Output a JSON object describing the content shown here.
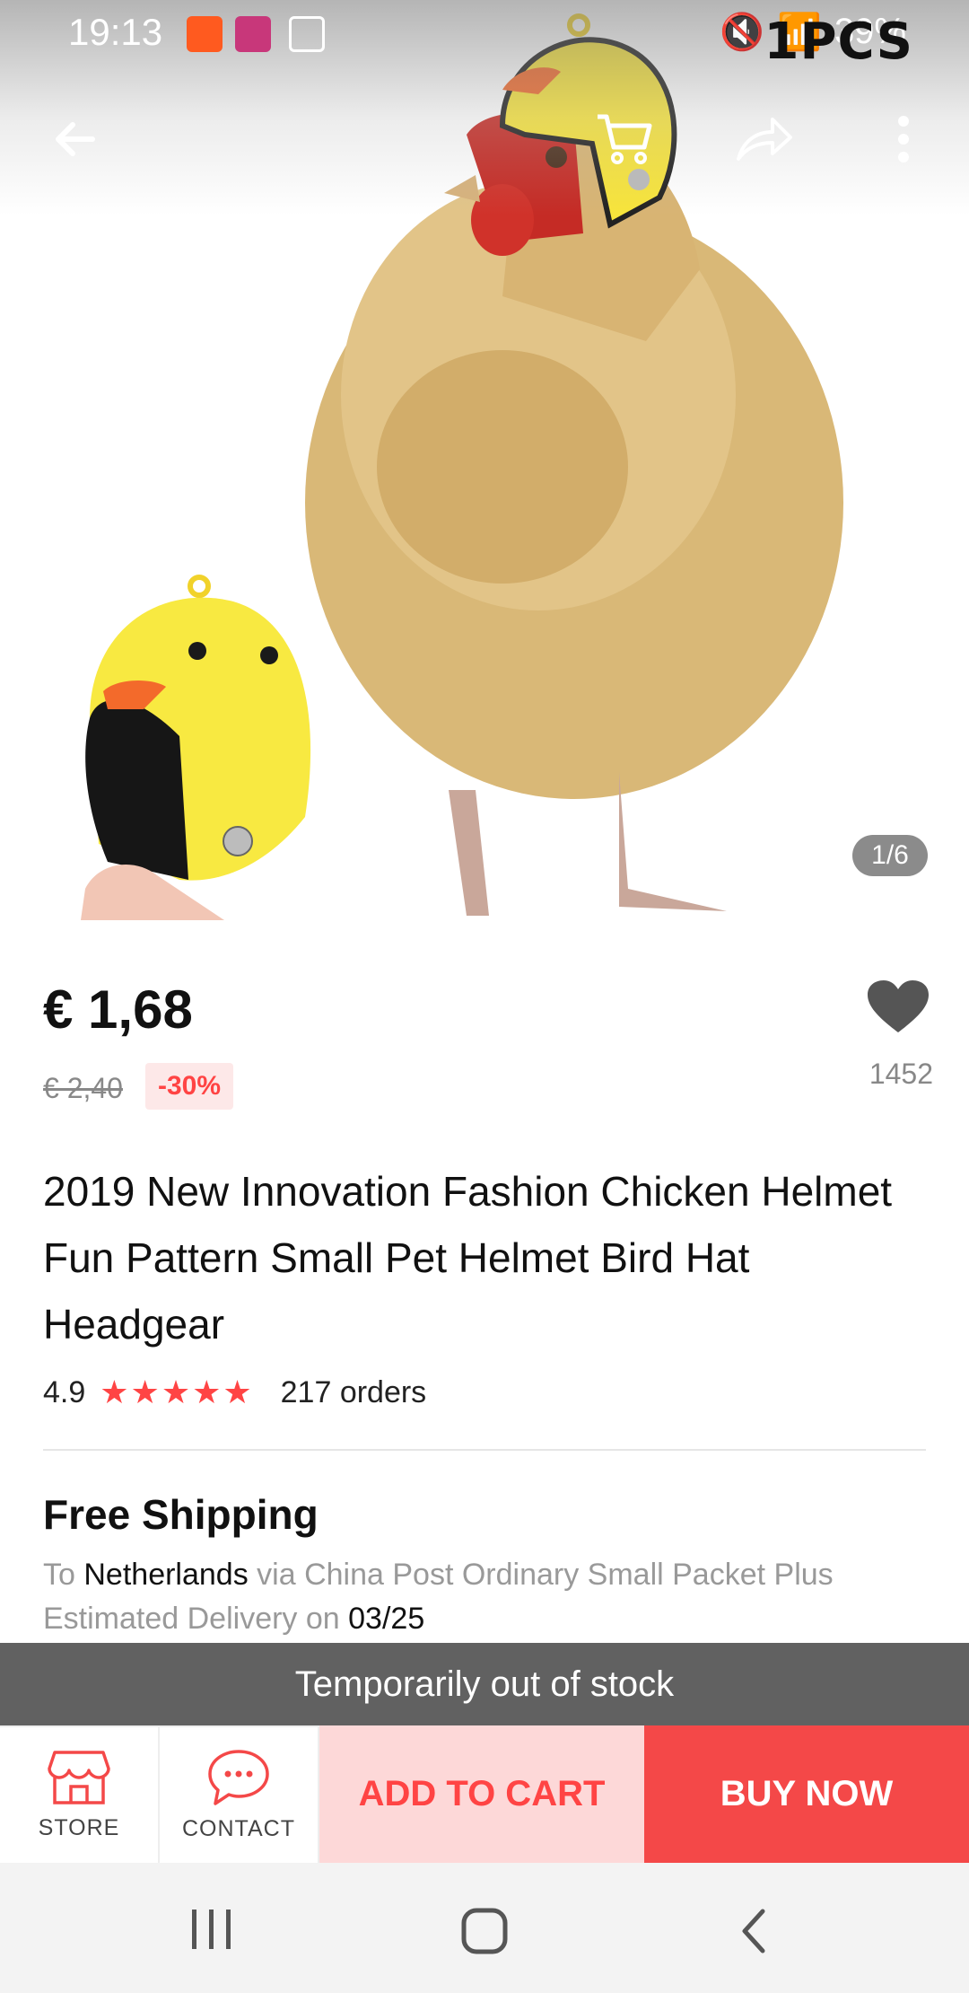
{
  "status": {
    "time": "19:13",
    "battery": "39%",
    "overlay_text": "1PCS"
  },
  "gallery": {
    "counter": "1/6"
  },
  "product": {
    "price": "€ 1,68",
    "original_price": "€ 2,40",
    "discount": "-30%",
    "wishlist_count": "1452",
    "title": "2019 New Innovation Fashion Chicken Helmet Fun Pattern Small Pet Helmet Bird Hat Headgear",
    "rating": "4.9",
    "stars": "★★★★★",
    "orders": "217 orders"
  },
  "shipping": {
    "title": "Free Shipping",
    "to_prefix": "To",
    "country": "Netherlands",
    "via": "via China Post Ordinary Small Packet Plus",
    "estimated_prefix": "Estimated Delivery on",
    "date": "03/25"
  },
  "notice": "Temporarily out of stock",
  "actions": {
    "store": "STORE",
    "contact": "CONTACT",
    "add_to_cart": "ADD TO CART",
    "buy_now": "BUY NOW"
  },
  "colors": {
    "accent": "#f44848",
    "accent_light": "#fdd8d8",
    "notice_bg": "#616161"
  }
}
